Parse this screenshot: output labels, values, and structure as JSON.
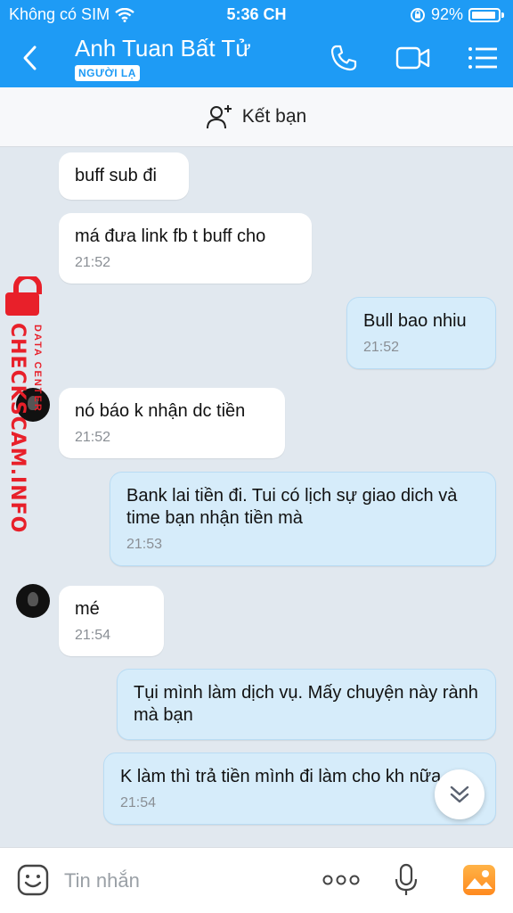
{
  "status_bar": {
    "carrier": "Không có SIM",
    "time": "5:36 CH",
    "battery": "92%"
  },
  "header": {
    "title": "Anh Tuan Bất Tử",
    "badge": "NGƯỜI LẠ"
  },
  "add_friend": {
    "label": "Kết bạn"
  },
  "messages": [
    {
      "direction": "in",
      "text": "buff sub đi",
      "time": ""
    },
    {
      "direction": "in",
      "text": "má đưa link fb t buff cho",
      "time": "21:52"
    },
    {
      "direction": "out",
      "text": "Bull bao nhiu",
      "time": "21:52"
    },
    {
      "direction": "in",
      "text": "nó báo k nhận dc tiền",
      "time": "21:52"
    },
    {
      "direction": "out",
      "text": "Bank lai tiền đi. Tui có lịch sự giao dich và time bạn nhận tiền mà",
      "time": "21:53"
    },
    {
      "direction": "in",
      "text": "mé",
      "time": "21:54"
    },
    {
      "direction": "out",
      "text": "Tụi mình làm dịch vụ. Mấy chuyện này rành mà bạn",
      "time": ""
    },
    {
      "direction": "out",
      "text": "K làm thì trả tiền mình đi làm cho kh nữa.",
      "time": "21:54"
    }
  ],
  "watermark": {
    "main": "CHECKSCAM.INFO",
    "sub": "DATA CENTER"
  },
  "input": {
    "placeholder": "Tin nhắn"
  },
  "colors": {
    "header_bg": "#1e9bf5",
    "chat_bg": "#e1e8ef",
    "out_bubble": "#d6ecfa",
    "in_bubble": "#ffffff",
    "watermark": "#e8202a"
  }
}
